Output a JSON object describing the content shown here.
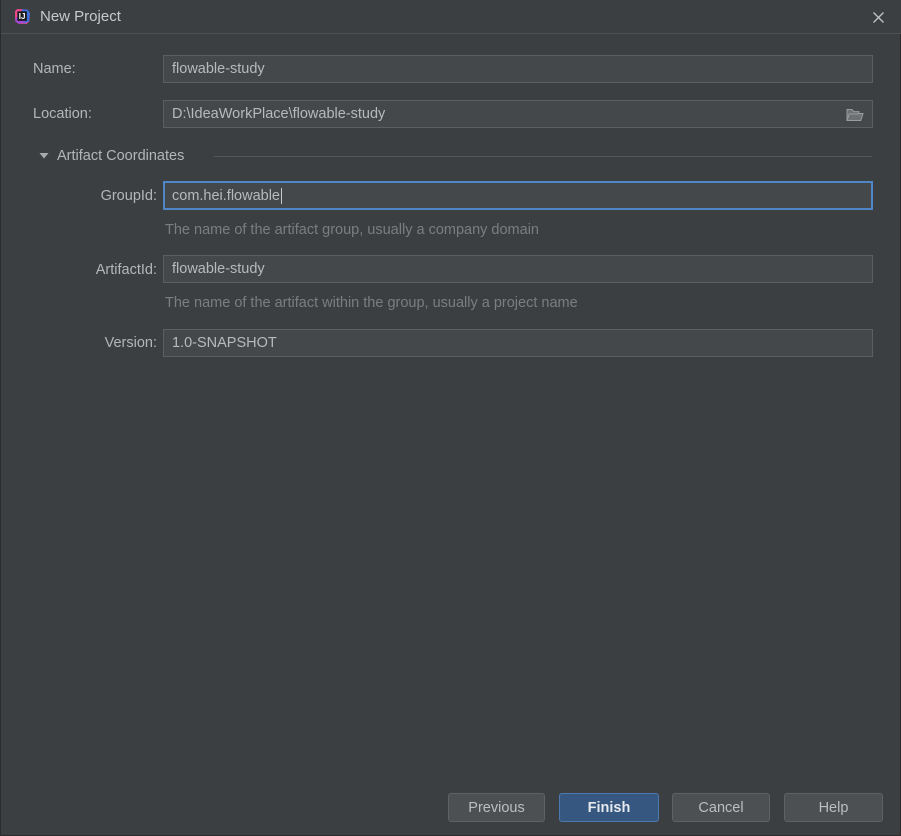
{
  "window": {
    "title": "New Project",
    "app_icon": "intellij-idea-icon",
    "close_icon": "close-icon"
  },
  "form": {
    "name": {
      "label": "Name:",
      "value": "flowable-study",
      "placeholder": ""
    },
    "location": {
      "label": "Location:",
      "value": "D:\\IdeaWorkPlace\\flowable-study",
      "placeholder": "",
      "browse_icon": "folder-icon"
    },
    "section": {
      "label": "Artifact Coordinates",
      "toggle_icon": "chevron-down-icon",
      "expanded": true
    },
    "group_id": {
      "label": "GroupId:",
      "value": "com.hei.flowable",
      "placeholder": "",
      "hint": "The name of the artifact group, usually a company domain",
      "focused": true
    },
    "artifact_id": {
      "label": "ArtifactId:",
      "value": "flowable-study",
      "placeholder": "",
      "hint": "The name of the artifact within the group, usually a project name"
    },
    "version": {
      "label": "Version:",
      "value": "1.0-SNAPSHOT",
      "placeholder": ""
    }
  },
  "footer": {
    "previous": "Previous",
    "finish": "Finish",
    "cancel": "Cancel",
    "help": "Help"
  },
  "colors": {
    "background": "#3c3f41",
    "field_background": "#45484a",
    "focus_border": "#4f86c6",
    "default_button": "#365880",
    "text": "#b4b6b8",
    "hint_text": "#7b7e80"
  }
}
